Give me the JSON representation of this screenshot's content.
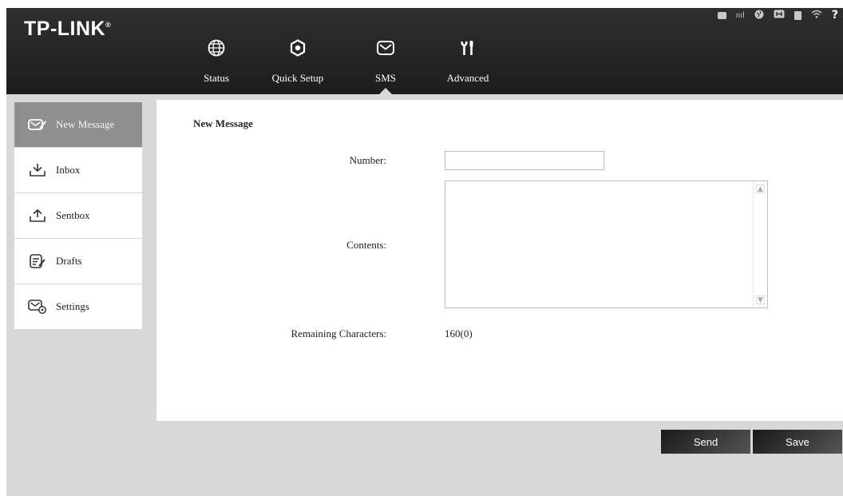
{
  "header": {
    "logo": "TP-LINK",
    "logo_mark": "®",
    "status_icons": [
      "sms-status-icon",
      "signal-icon",
      "internet-globe-icon",
      "connection-icon",
      "sim-card-icon",
      "wifi-icon",
      "help-icon"
    ],
    "signal_text": "ıııl",
    "help_text": "?"
  },
  "nav": [
    {
      "label": "Status",
      "icon": "globe-icon"
    },
    {
      "label": "Quick Setup",
      "icon": "quick-setup-icon"
    },
    {
      "label": "SMS",
      "icon": "envelope-icon",
      "active": true
    },
    {
      "label": "Advanced",
      "icon": "tools-icon"
    }
  ],
  "sidebar": {
    "items": [
      {
        "label": "New Message",
        "icon": "new-message-icon",
        "active": true
      },
      {
        "label": "Inbox",
        "icon": "inbox-icon"
      },
      {
        "label": "Sentbox",
        "icon": "sentbox-icon"
      },
      {
        "label": "Drafts",
        "icon": "drafts-icon"
      },
      {
        "label": "Settings",
        "icon": "sms-settings-icon"
      }
    ]
  },
  "form": {
    "title": "New Message",
    "number_label": "Number:",
    "number_value": "",
    "contents_label": "Contents:",
    "contents_value": "",
    "remaining_label": "Remaining Characters:",
    "remaining_value": "160(0)"
  },
  "buttons": {
    "send": "Send",
    "save": "Save"
  },
  "colors": {
    "header_bg": "#222222",
    "page_bg": "#d8d8d8",
    "sidebar_active": "#8f8f8f",
    "button_bg": "#2a2a2a"
  }
}
